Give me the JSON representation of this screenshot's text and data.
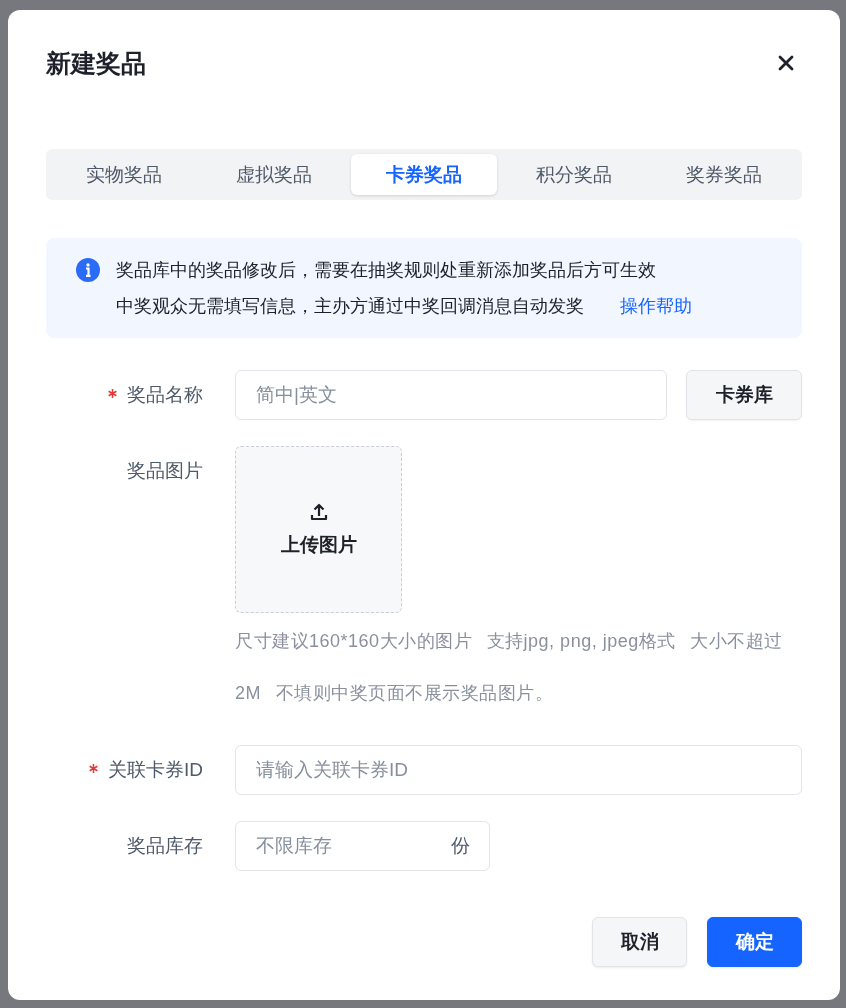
{
  "dialog": {
    "title": "新建奖品"
  },
  "tabs": [
    {
      "label": "实物奖品",
      "selected": false
    },
    {
      "label": "虚拟奖品",
      "selected": false
    },
    {
      "label": "卡券奖品",
      "selected": true
    },
    {
      "label": "积分奖品",
      "selected": false
    },
    {
      "label": "奖券奖品",
      "selected": false
    }
  ],
  "notice": {
    "lines": [
      "奖品库中的奖品修改后，需要在抽奖规则处重新添加奖品后方可生效",
      "中奖观众无需填写信息，主办方通过中奖回调消息自动发奖"
    ],
    "link": "操作帮助"
  },
  "form": {
    "fields": [
      {
        "kind": "text_with_button",
        "label": "奖品名称",
        "required": true,
        "placeholder": "简中|英文",
        "button": "卡券库"
      },
      {
        "kind": "upload",
        "label": "奖品图片",
        "required": false,
        "upload_label": "上传图片",
        "hints": [
          "尺寸建议160*160大小的图片",
          "支持jpg, png, jpeg格式",
          "大小不超过2M",
          "不填则中奖页面不展示奖品图片。"
        ]
      },
      {
        "kind": "text",
        "label": "关联卡券ID",
        "required": true,
        "placeholder": "请输入关联卡券ID"
      },
      {
        "kind": "text_with_unit",
        "label": "奖品库存",
        "required": false,
        "placeholder": "不限库存",
        "unit": "份"
      }
    ]
  },
  "footer": {
    "buttons": [
      {
        "kind": "secondary",
        "label": "取消"
      },
      {
        "kind": "primary",
        "label": "确定"
      }
    ]
  }
}
